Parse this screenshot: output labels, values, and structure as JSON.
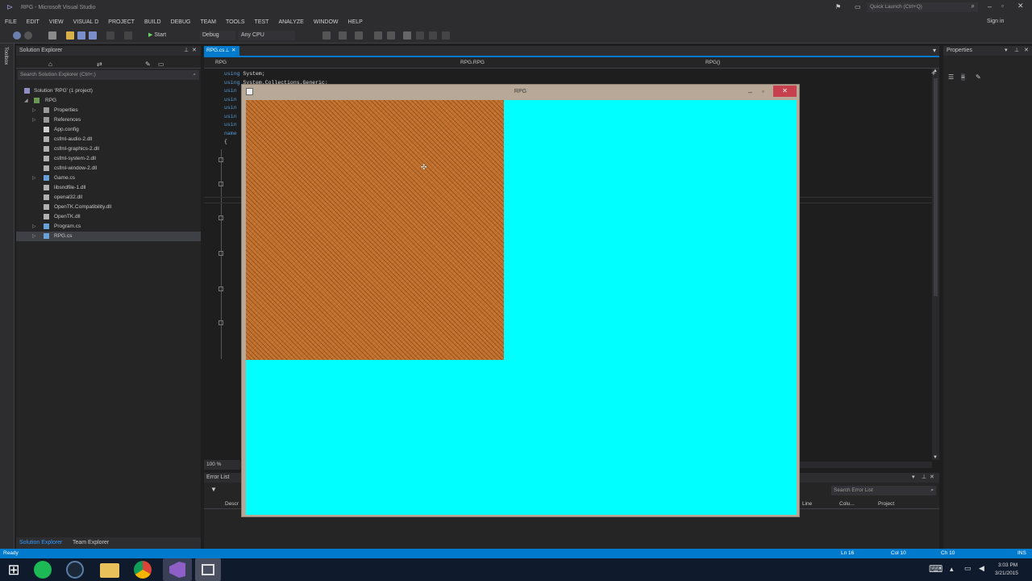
{
  "window": {
    "title": "RPG - Microsoft Visual Studio",
    "quick_launch": "Quick Launch (Ctrl+Q)",
    "sign_in": "Sign in"
  },
  "menu": [
    "FILE",
    "EDIT",
    "VIEW",
    "VISUAL D",
    "PROJECT",
    "BUILD",
    "DEBUG",
    "TEAM",
    "TOOLS",
    "TEST",
    "ANALYZE",
    "WINDOW",
    "HELP"
  ],
  "toolbar": {
    "start_label": "Start",
    "config": "Debug",
    "platform": "Any CPU"
  },
  "toolbox_label": "Toolbox",
  "solution_explorer": {
    "title": "Solution Explorer",
    "search_placeholder": "Search Solution Explorer (Ctrl+;)",
    "solution": "Solution 'RPG' (1 project)",
    "project": "RPG",
    "items": [
      {
        "label": "Properties",
        "icon": "wrench-icon"
      },
      {
        "label": "References",
        "icon": "references-icon"
      },
      {
        "label": "App.config",
        "icon": "config-file-icon"
      },
      {
        "label": "csfml-audio-2.dll",
        "icon": "dll-icon"
      },
      {
        "label": "csfml-graphics-2.dll",
        "icon": "dll-icon"
      },
      {
        "label": "csfml-system-2.dll",
        "icon": "dll-icon"
      },
      {
        "label": "csfml-window-2.dll",
        "icon": "dll-icon"
      },
      {
        "label": "Game.cs",
        "icon": "csharp-file-icon"
      },
      {
        "label": "libsndfile-1.dll",
        "icon": "dll-icon"
      },
      {
        "label": "openal32.dll",
        "icon": "dll-icon"
      },
      {
        "label": "OpenTK.Compatibility.dll",
        "icon": "dll-icon"
      },
      {
        "label": "OpenTK.dll",
        "icon": "dll-icon"
      },
      {
        "label": "Program.cs",
        "icon": "csharp-file-icon"
      },
      {
        "label": "RPG.cs",
        "icon": "csharp-file-icon"
      }
    ],
    "bottom_tabs": [
      "Solution Explorer",
      "Team Explorer"
    ]
  },
  "editor": {
    "tab": "RPG.cs",
    "nav": [
      "RPG",
      "RPG.RPG",
      "RPG()"
    ],
    "code_lines": [
      "using System;",
      "using System.Collections.Generic;",
      "usin",
      "usin",
      "usin",
      "usin",
      "usin",
      "name",
      "{"
    ],
    "zoom": "100 %"
  },
  "error_list": {
    "title": "Error List",
    "search_placeholder": "Search Error List",
    "columns": [
      "Descr",
      "Line",
      "Colu...",
      "Project"
    ]
  },
  "properties": {
    "title": "Properties"
  },
  "status": {
    "ready": "Ready",
    "ln": "Ln 16",
    "col": "Col 10",
    "ch": "Ch 10",
    "ins": "INS"
  },
  "game_window": {
    "title": "RPG"
  },
  "clock": {
    "time": "3:03 PM",
    "date": "3/21/2015"
  },
  "colors": {
    "accent": "#007acc",
    "game_background": "#00ffff",
    "brick": "#c1712e"
  }
}
